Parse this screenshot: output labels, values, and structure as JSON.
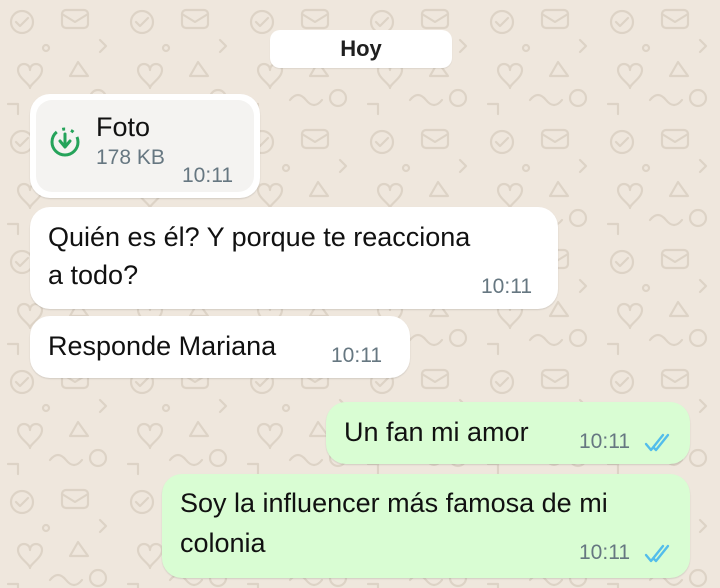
{
  "chat": {
    "date_label": "Hoy",
    "messages": [
      {
        "direction": "incoming",
        "type": "attachment",
        "attachment": {
          "title": "Foto",
          "size": "178 KB",
          "icon": "download-icon"
        },
        "time": "10:11"
      },
      {
        "direction": "incoming",
        "type": "text",
        "lines": [
          "Quién es él? Y porque te reacciona",
          "a todo?"
        ],
        "time": "10:11"
      },
      {
        "direction": "incoming",
        "type": "text",
        "lines": [
          "Responde Mariana"
        ],
        "time": "10:11"
      },
      {
        "direction": "outgoing",
        "type": "text",
        "lines": [
          "Un fan mi amor"
        ],
        "time": "10:11",
        "status": "read"
      },
      {
        "direction": "outgoing",
        "type": "text",
        "lines": [
          "Soy la influencer más famosa de mi",
          "colonia"
        ],
        "time": "10:11",
        "status": "read"
      }
    ]
  },
  "colors": {
    "background": "#efe7dd",
    "incoming_bubble": "#ffffff",
    "outgoing_bubble": "#d9fdd3",
    "read_ticks": "#53bdeb",
    "download_icon": "#25a35a",
    "timestamp": "#667781"
  }
}
